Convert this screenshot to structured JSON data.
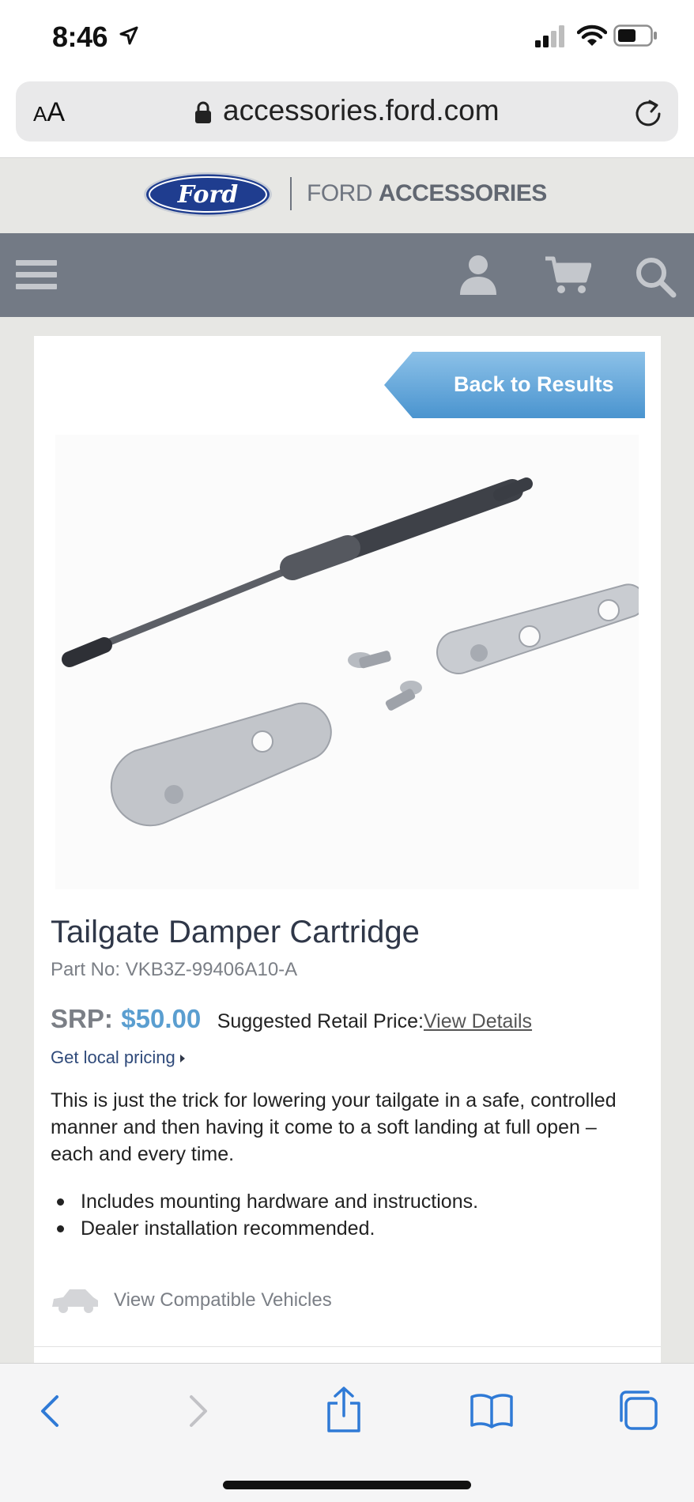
{
  "status_bar": {
    "time": "8:46",
    "icons": [
      "location-arrow-icon",
      "cellular-signal-icon",
      "wifi-icon",
      "battery-icon"
    ]
  },
  "browser": {
    "text_size_label_small": "A",
    "text_size_label_large": "A",
    "url": "accessories.ford.com",
    "icons": [
      "lock-icon",
      "reload-icon"
    ]
  },
  "header": {
    "logo_text": "Ford",
    "brand_prefix": "FORD",
    "brand_suffix": "ACCESSORIES"
  },
  "nav": {
    "icons": [
      "menu-icon",
      "user-icon",
      "cart-icon",
      "search-icon"
    ],
    "color": "#737a85"
  },
  "product": {
    "back_label": "Back to Results",
    "title": "Tailgate Damper Cartridge",
    "part_label": "Part No:",
    "part_number": "VKB3Z-99406A10-A",
    "srp_label": "SRP:",
    "srp_value": "$50.00",
    "srp_description": "Suggested Retail Price:",
    "view_details": "View Details",
    "local_pricing": "Get local pricing",
    "description": "This is just the trick for lowering your tailgate in a safe, controlled manner and then having it come to a soft landing at full open – each and every time.",
    "bullets": [
      "Includes mounting hardware and instructions.",
      "Dealer installation recommended."
    ],
    "compatible_label": "View Compatible Vehicles",
    "accent_color": "#5a9ed0"
  },
  "toolbar": {
    "icons": [
      "back-arrow-icon",
      "forward-arrow-icon",
      "share-icon",
      "bookmarks-icon",
      "tabs-icon"
    ],
    "accent_color": "#2f7ad6"
  }
}
